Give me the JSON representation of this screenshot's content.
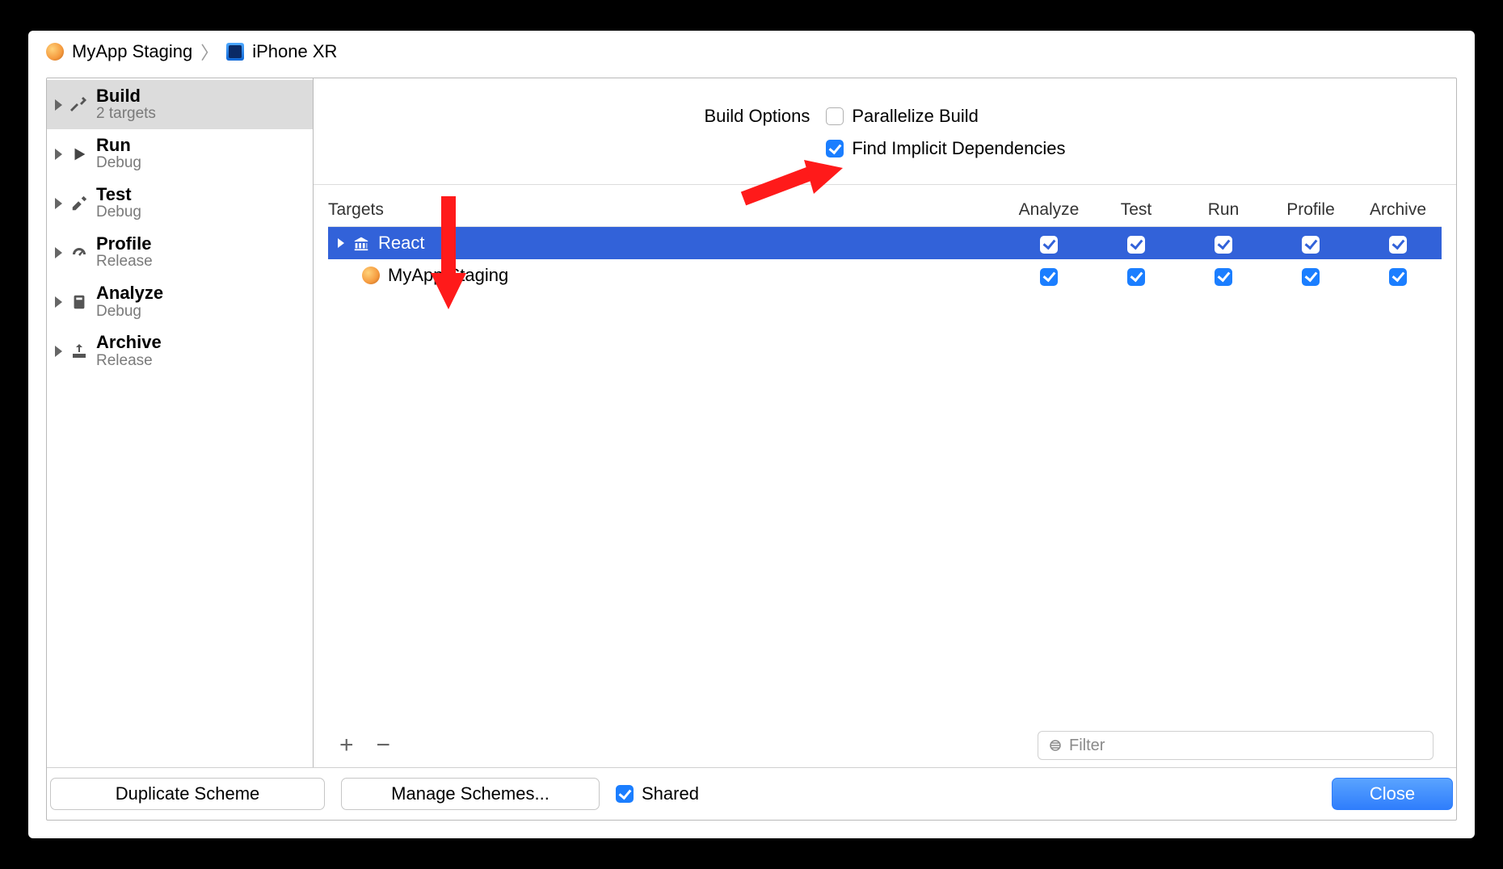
{
  "breadcrumb": {
    "scheme": "MyApp Staging",
    "device": "iPhone XR"
  },
  "sidebar": {
    "items": [
      {
        "title": "Build",
        "sub": "2 targets",
        "selected": true
      },
      {
        "title": "Run",
        "sub": "Debug",
        "selected": false
      },
      {
        "title": "Test",
        "sub": "Debug",
        "selected": false
      },
      {
        "title": "Profile",
        "sub": "Release",
        "selected": false
      },
      {
        "title": "Analyze",
        "sub": "Debug",
        "selected": false
      },
      {
        "title": "Archive",
        "sub": "Release",
        "selected": false
      }
    ]
  },
  "build_options": {
    "label": "Build Options",
    "parallelize": {
      "label": "Parallelize Build",
      "checked": false
    },
    "implicit": {
      "label": "Find Implicit Dependencies",
      "checked": true
    }
  },
  "table": {
    "headers": {
      "targets": "Targets",
      "analyze": "Analyze",
      "test": "Test",
      "run": "Run",
      "profile": "Profile",
      "archive": "Archive"
    },
    "rows": [
      {
        "name": "React",
        "icon": "framework",
        "selected": true,
        "analyze": true,
        "test": true,
        "run": true,
        "profile": true,
        "archive": true
      },
      {
        "name": "MyApp Staging",
        "icon": "app",
        "selected": false,
        "analyze": true,
        "test": true,
        "run": true,
        "profile": true,
        "archive": true
      }
    ]
  },
  "filter": {
    "placeholder": "Filter"
  },
  "buttons": {
    "duplicate": "Duplicate Scheme",
    "manage": "Manage Schemes...",
    "shared": "Shared",
    "close": "Close"
  }
}
